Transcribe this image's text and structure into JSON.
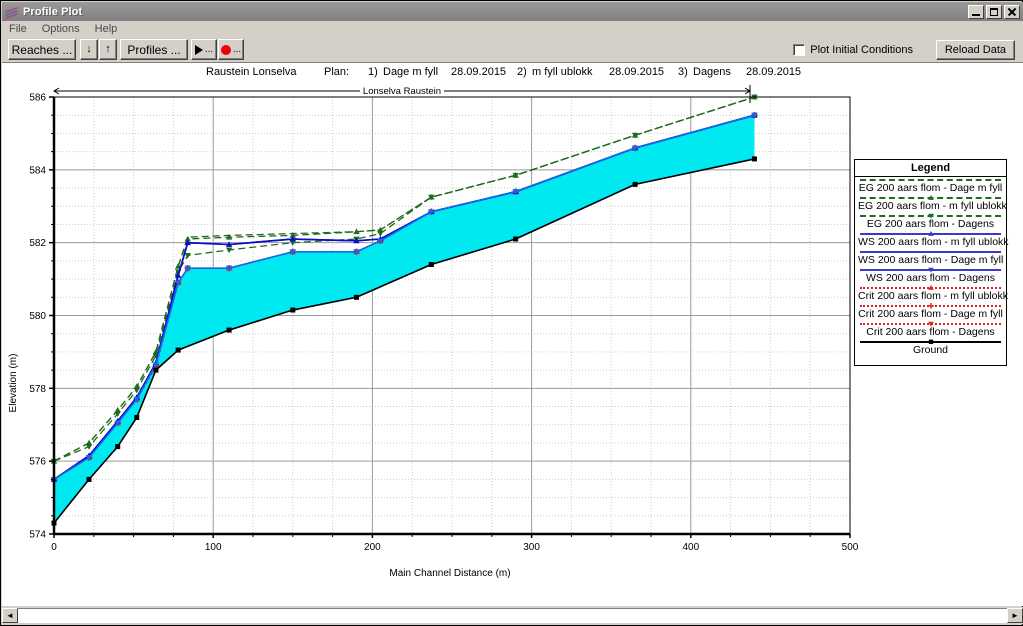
{
  "window": {
    "title": "Profile Plot",
    "icon": "profile-plot-icon",
    "minimize_label": "Minimize",
    "maximize_label": "Maximize",
    "close_label": "Close"
  },
  "menu": {
    "items": [
      "File",
      "Options",
      "Help"
    ]
  },
  "toolbar": {
    "reaches_label": "Reaches ...",
    "profiles_label": "Profiles ...",
    "down_arrow": "↓",
    "up_arrow": "↑",
    "play_label": "...",
    "record_label": "...",
    "plot_initial_conditions_label": "Plot Initial Conditions",
    "plot_initial_conditions_checked": false,
    "reload_label": "Reload Data"
  },
  "plan_header": {
    "river_reach": "Raustein Lonselva",
    "plan_label": "Plan:",
    "plans": [
      {
        "index": "1)",
        "name": "Dage m fyll",
        "date": "28.09.2015"
      },
      {
        "index": "2)",
        "name": "m fyll ublokk",
        "date": "28.09.2015"
      },
      {
        "index": "3)",
        "name": "Dagens",
        "date": "28.09.2015"
      }
    ]
  },
  "reach_annotation": {
    "label": "Lonselva Raustein"
  },
  "legend": {
    "title": "Legend",
    "entries": [
      {
        "label": "EG  200 aars flom - Dage m fyll",
        "color": "#1f6b1f",
        "style": "dashed",
        "marker": "none"
      },
      {
        "label": "EG  200 aars flom - m fyll ublokk",
        "color": "#1f6b1f",
        "style": "dashed",
        "marker": "triangle-up"
      },
      {
        "label": "EG  200 aars flom - Dagens",
        "color": "#1f6b1f",
        "style": "dashed",
        "marker": "triangle-down"
      },
      {
        "label": "WS  200 aars flom - m fyll ublokk",
        "color": "#3a3ad0",
        "style": "solid",
        "marker": "triangle-up"
      },
      {
        "label": "WS  200 aars flom - Dage m fyll",
        "color": "#3a3ad0",
        "style": "solid",
        "marker": "none"
      },
      {
        "label": "WS  200 aars flom - Dagens",
        "color": "#3a3ad0",
        "style": "solid",
        "marker": "triangle-down"
      },
      {
        "label": "Crit  200 aars flom - m fyll ublokk",
        "color": "#dd2222",
        "style": "dotted",
        "marker": "triangle-up"
      },
      {
        "label": "Crit  200 aars flom - Dage m fyll",
        "color": "#dd2222",
        "style": "dotted",
        "marker": "plus"
      },
      {
        "label": "Crit  200 aars flom - Dagens",
        "color": "#dd2222",
        "style": "dotted",
        "marker": "triangle-down"
      },
      {
        "label": "Ground",
        "color": "#000000",
        "style": "solid",
        "marker": "square"
      }
    ]
  },
  "chart_data": {
    "type": "line",
    "title": "Raustein Lonselva",
    "xlabel": "Main Channel Distance (m)",
    "ylabel": "Elevation (m)",
    "xlim": [
      0,
      500
    ],
    "ylim": [
      574,
      586
    ],
    "xticks": [
      0,
      100,
      200,
      300,
      400,
      500
    ],
    "yticks": [
      574,
      576,
      578,
      580,
      582,
      584,
      586
    ],
    "minor_x_step": 25,
    "minor_y_step": 0.5,
    "grid": true,
    "legend_position": "right",
    "fill_between": {
      "upper": "ws_dagens",
      "lower": "ground",
      "color": "#00e8f0"
    },
    "x": [
      0,
      22,
      40,
      52,
      64,
      78,
      84,
      110,
      150,
      190,
      205,
      237,
      290,
      365,
      440
    ],
    "series": [
      {
        "name": "EG  200 aars flom - Dage m fyll",
        "color": "#1f6b1f",
        "style": "dashed",
        "marker": "none",
        "x": [
          0,
          22,
          40,
          52,
          64,
          78,
          84,
          110,
          150,
          190,
          205,
          237,
          290,
          365,
          440
        ],
        "values": [
          576.0,
          576.5,
          577.4,
          578.05,
          579.0,
          581.35,
          582.15,
          582.2,
          582.25,
          582.3,
          582.35,
          583.25,
          583.85,
          584.95,
          586.0
        ]
      },
      {
        "name": "EG  200 aars flom - m fyll ublokk",
        "color": "#1f6b1f",
        "style": "dashed",
        "marker": "triangle-up",
        "x": [
          0,
          22,
          40,
          52,
          64,
          78,
          84,
          110,
          150,
          190,
          205,
          237,
          290,
          365,
          440
        ],
        "values": [
          576.0,
          576.5,
          577.4,
          578.05,
          579.0,
          581.35,
          582.1,
          582.15,
          582.2,
          582.3,
          582.35,
          583.25,
          583.85,
          584.95,
          586.0
        ]
      },
      {
        "name": "EG  200 aars flom - Dagens",
        "color": "#1f6b1f",
        "style": "dashed",
        "marker": "triangle-down",
        "x": [
          0,
          22,
          40,
          52,
          64,
          78,
          84,
          110,
          150,
          190,
          205,
          237,
          290,
          365,
          440
        ],
        "values": [
          576.0,
          576.4,
          577.3,
          577.95,
          578.9,
          581.2,
          581.65,
          581.8,
          582.0,
          582.1,
          582.25,
          583.25,
          583.85,
          584.95,
          586.0
        ]
      },
      {
        "name": "WS  200 aars flom - Dage m fyll",
        "color": "#0a0acd",
        "style": "solid",
        "marker": "none",
        "x": [
          0,
          22,
          40,
          52,
          64,
          78,
          84,
          110,
          150,
          190,
          205,
          237,
          290,
          365,
          440
        ],
        "values": [
          575.5,
          576.15,
          577.1,
          577.75,
          578.7,
          581.1,
          582.0,
          581.95,
          582.1,
          582.05,
          582.1,
          582.85,
          583.4,
          584.6,
          585.5
        ]
      },
      {
        "name": "WS  200 aars flom - m fyll ublokk",
        "color": "#0a0acd",
        "style": "solid",
        "marker": "triangle-up",
        "x": [
          0,
          22,
          40,
          52,
          64,
          78,
          84,
          110,
          150,
          190,
          205,
          237,
          290,
          365,
          440
        ],
        "values": [
          575.5,
          576.15,
          577.1,
          577.75,
          578.7,
          581.1,
          582.0,
          581.95,
          582.1,
          582.05,
          582.1,
          582.85,
          583.4,
          584.6,
          585.5
        ]
      },
      {
        "name": "WS  200 aars flom - Dagens",
        "color": "#1568e8",
        "style": "solid",
        "marker": "triangle-down",
        "x": [
          0,
          22,
          40,
          52,
          64,
          78,
          84,
          110,
          150,
          190,
          205,
          237,
          290,
          365,
          440
        ],
        "values": [
          575.5,
          576.1,
          577.05,
          577.7,
          578.65,
          580.9,
          581.3,
          581.3,
          581.75,
          581.75,
          582.05,
          582.85,
          583.4,
          584.6,
          585.5
        ]
      },
      {
        "name": "Crit  200 aars flom - m fyll ublokk",
        "color": "#dd2222",
        "style": "dotted",
        "marker": "triangle-up",
        "x": [
          0,
          22,
          40,
          52,
          64,
          78,
          84,
          110,
          150,
          190,
          205,
          237,
          290,
          365,
          440
        ],
        "values": [
          575.5,
          576.1,
          577.05,
          577.7,
          578.6,
          580.9,
          581.3,
          581.3,
          581.75,
          581.75,
          582.05,
          582.85,
          583.4,
          584.6,
          585.5
        ]
      },
      {
        "name": "Crit  200 aars flom - Dage m fyll",
        "color": "#dd2222",
        "style": "dotted",
        "marker": "plus",
        "x": [
          0,
          22,
          40,
          52,
          64,
          78,
          84,
          110,
          150,
          190,
          205,
          237,
          290,
          365,
          440
        ],
        "values": [
          575.5,
          576.1,
          577.05,
          577.7,
          578.6,
          580.9,
          581.3,
          581.3,
          581.75,
          581.75,
          582.05,
          582.85,
          583.4,
          584.6,
          585.5
        ]
      },
      {
        "name": "Crit  200 aars flom - Dagens",
        "color": "#dd2222",
        "style": "dotted",
        "marker": "triangle-down",
        "x": [
          0,
          22,
          40,
          52,
          64,
          78,
          84,
          110,
          150,
          190,
          205,
          237,
          290,
          365,
          440
        ],
        "values": [
          575.5,
          576.1,
          577.05,
          577.7,
          578.6,
          580.9,
          581.3,
          581.3,
          581.75,
          581.75,
          582.05,
          582.85,
          583.4,
          584.6,
          585.5
        ]
      },
      {
        "name": "Ground",
        "color": "#000000",
        "style": "solid",
        "marker": "square",
        "x": [
          0,
          22,
          40,
          52,
          64,
          78,
          110,
          150,
          190,
          237,
          290,
          365,
          440
        ],
        "values": [
          574.3,
          575.5,
          576.4,
          577.2,
          578.5,
          579.05,
          579.6,
          580.15,
          580.5,
          581.4,
          582.1,
          583.6,
          584.3
        ]
      }
    ]
  },
  "scrollbar": {
    "left_arrow": "◄",
    "right_arrow": "►"
  }
}
